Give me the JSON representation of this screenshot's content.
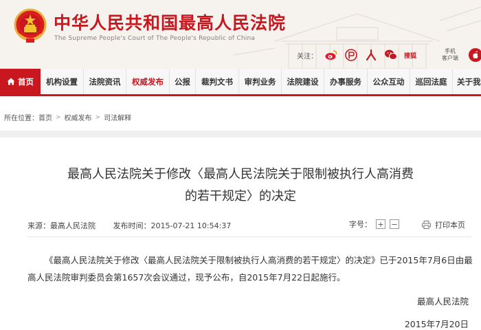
{
  "site": {
    "title": "中华人民共和国最高人民法院",
    "subtitle": "The Supreme People's Court of The People's Republic of China",
    "follow_label": "关注：",
    "follow_icons": [
      "weibo-icon",
      "people-daily-icon",
      "renren-icon",
      "wechat-icon"
    ],
    "sohu_label": "搜狐",
    "mobile_label_line1": "手机",
    "mobile_label_line2": "客户端"
  },
  "nav": {
    "items": [
      {
        "label": "首页"
      },
      {
        "label": "机构设置"
      },
      {
        "label": "法院资讯"
      },
      {
        "label": "权威发布"
      },
      {
        "label": "公报"
      },
      {
        "label": "裁判文书"
      },
      {
        "label": "审判业务"
      },
      {
        "label": "法院建设"
      },
      {
        "label": "办事服务"
      },
      {
        "label": "公众互动"
      },
      {
        "label": "巡回法庭"
      },
      {
        "label": "关于我"
      }
    ]
  },
  "breadcrumb": {
    "prefix": "所在位置：",
    "items": [
      "首页",
      "权威发布",
      "司法解释"
    ]
  },
  "article": {
    "title_line1": "最高人民法院关于修改〈最高人民法院关于限制被执行人高消费",
    "title_line2": "的若干规定〉的决定",
    "source": "来源：最高人民法院",
    "published": "发布时间：2015-07-21 10:54:37",
    "fontsize_label": "字号：",
    "fontsize_plus": "+",
    "fontsize_minus": "−",
    "print_label": "打印本页",
    "paragraph": "《最高人民法院关于修改〈最高人民法院关于限制被执行人高消费的若干规定〉的决定》已于2015年7月6日由最高人民法院审判委员会第1657次会议通过，现予公布，自2015年7月22日起施行。",
    "signer": "最高人民法院",
    "date": "2015年7月20日"
  },
  "colors": {
    "brand_red": "#c8171e",
    "nav_bg": "#f7f7f7",
    "header_bg": "#f6f3ef"
  }
}
